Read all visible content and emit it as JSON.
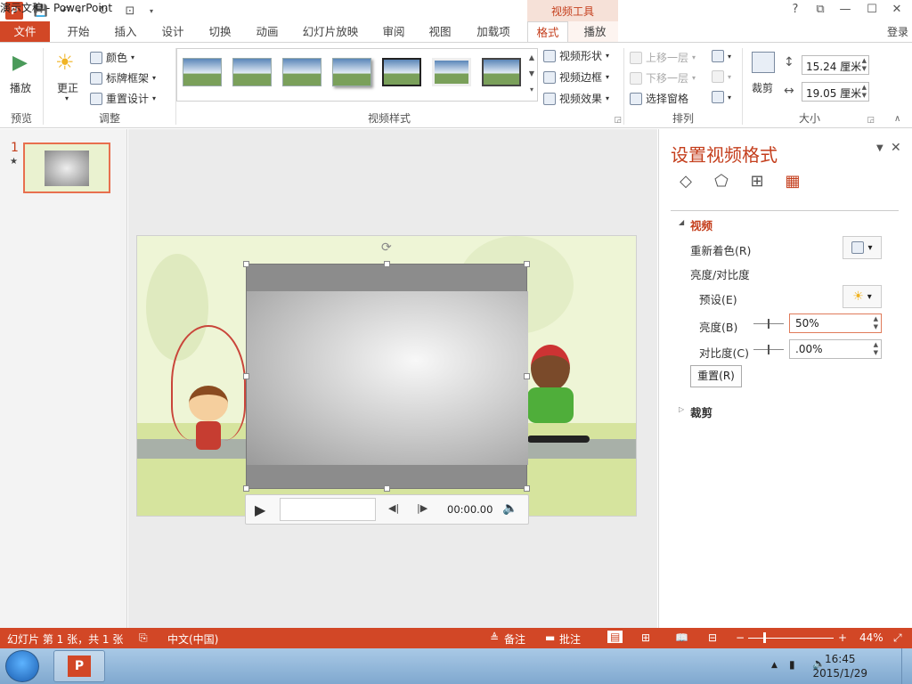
{
  "titlebar": {
    "title": "演示文稿 - PowerPoint",
    "context_label": "视频工具",
    "help": "?",
    "restore": "⧉",
    "minimize": "—",
    "maximize": "☐",
    "close": "✕"
  },
  "tabs": [
    {
      "label": "文件"
    },
    {
      "label": "开始"
    },
    {
      "label": "插入"
    },
    {
      "label": "设计"
    },
    {
      "label": "切换"
    },
    {
      "label": "动画"
    },
    {
      "label": "幻灯片放映"
    },
    {
      "label": "审阅"
    },
    {
      "label": "视图"
    },
    {
      "label": "加载项"
    },
    {
      "label": "格式"
    },
    {
      "label": "播放"
    }
  ],
  "login": "登录",
  "ribbon": {
    "preview": {
      "play": "播放",
      "group": "预览"
    },
    "adjust": {
      "correct": "更正",
      "color": "颜色",
      "poster": "标牌框架",
      "reset_design": "重置设计",
      "group": "调整"
    },
    "styles": {
      "group": "视频样式",
      "shape": "视频形状",
      "border": "视频边框",
      "effect": "视频效果"
    },
    "arrange": {
      "forward": "上移一层",
      "backward": "下移一层",
      "pane": "选择窗格",
      "group": "排列"
    },
    "size": {
      "crop": "裁剪",
      "height": "15.24 厘米",
      "width": "19.05 厘米",
      "group": "大小"
    }
  },
  "slides_pane": {
    "number": "1",
    "star": "★"
  },
  "player": {
    "time": "00:00.00"
  },
  "format_pane": {
    "title": "设置视频格式",
    "section_video": "视频",
    "recolor": "重新着色(R)",
    "brightness_contrast": "亮度/对比度",
    "preset": "预设(E)",
    "brightness_label": "亮度(B)",
    "brightness_value": "50%",
    "contrast_label": "对比度(C)",
    "contrast_value": ".00%",
    "reset": "重置(R)",
    "section_crop": "裁剪"
  },
  "statusbar": {
    "slide_info": "幻灯片 第 1 张，共 1 张",
    "language": "中文(中国)",
    "notes": "备注",
    "comments": "批注",
    "zoom": "44%",
    "zoom_level": 0.44
  },
  "taskbar": {
    "time": "16:45",
    "date": "2015/1/29"
  },
  "colors": {
    "accent": "#d24726",
    "context": "#c43e1c"
  }
}
